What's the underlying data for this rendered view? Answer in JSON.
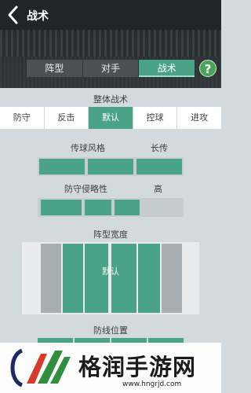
{
  "header": {
    "title": "战术"
  },
  "tabs": [
    {
      "label": "阵型",
      "active": false
    },
    {
      "label": "对手",
      "active": false
    },
    {
      "label": "战术",
      "active": true
    }
  ],
  "help": {
    "label": "?"
  },
  "overall": {
    "title": "整体战术",
    "options": [
      "防守",
      "反击",
      "默认",
      "控球",
      "进攻"
    ],
    "selected": "默认"
  },
  "passing": {
    "label": "传球风格",
    "value_label": "长传",
    "level_fraction": 1.0
  },
  "aggression": {
    "label": "防守侵略性",
    "value_label": "高",
    "level_fraction": 0.7
  },
  "width": {
    "label": "阵型宽度",
    "center_label": "默认"
  },
  "defline": {
    "label": "防线位置"
  },
  "watermark": {
    "title": "格润手游网",
    "url": "www.hngrjd.com"
  },
  "colors": {
    "accent": "#4aa387",
    "header_bg": "#1f2628",
    "help": "#4aa35a",
    "background": "#d3dade"
  }
}
